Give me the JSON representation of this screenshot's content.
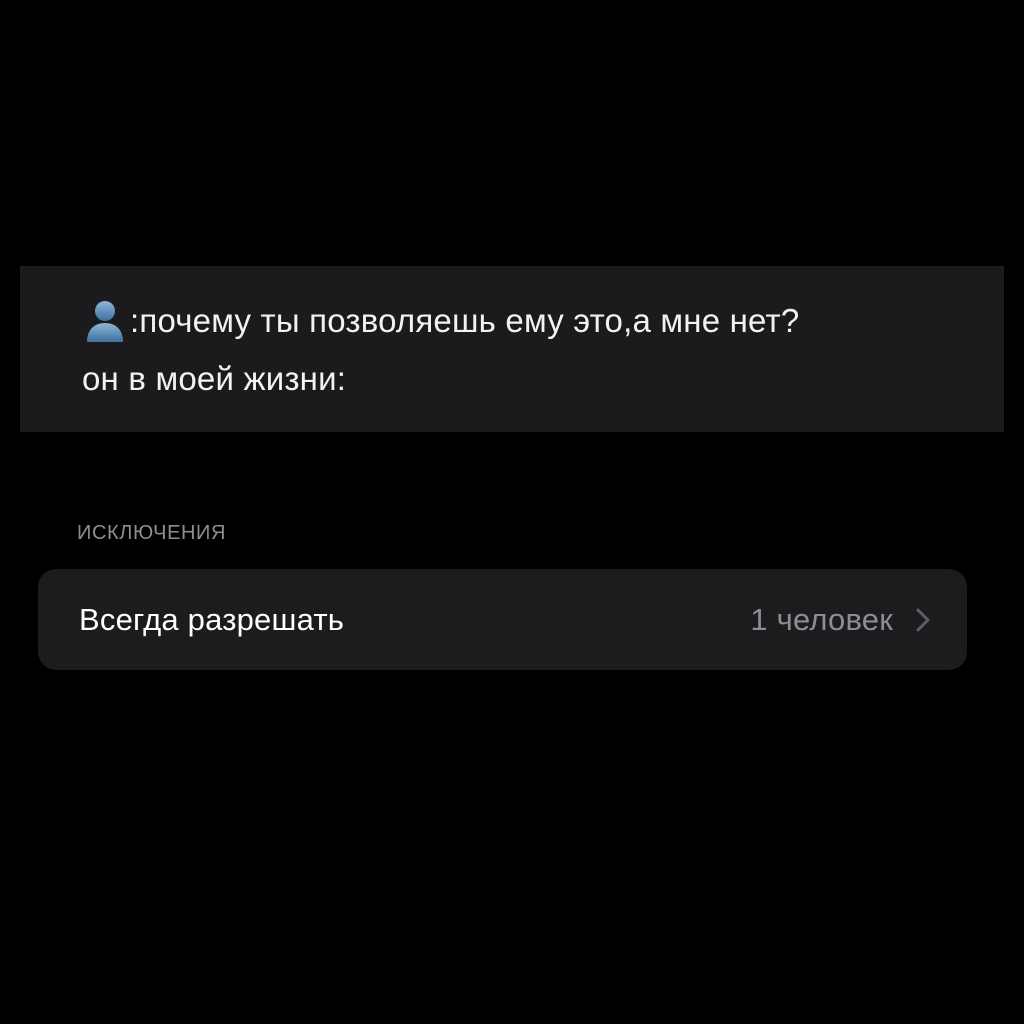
{
  "caption": {
    "line1": ":почему ты позволяешь ему это,а мне нет?",
    "line2": "он в моей жизни:",
    "icon": "person-silhouette-icon"
  },
  "exceptions": {
    "header": "ИСКЛЮЧЕНИЯ",
    "row": {
      "label": "Всегда разрешать",
      "value": "1 человек",
      "icon": "chevron-right-icon"
    }
  },
  "colors": {
    "background": "#000000",
    "panel": "#1c1c1e",
    "secondary_text": "#8d8d92",
    "icon_blue": "#6f9bc4"
  }
}
